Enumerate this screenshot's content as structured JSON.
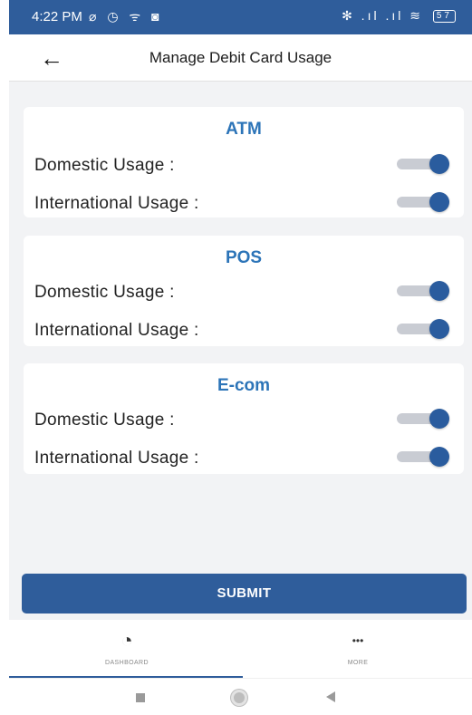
{
  "status_bar": {
    "time": "4:22 PM",
    "left_icons": "⌀ ◷ ᯤ ◙",
    "right_icons": "✻ .ıl .ıl ≋",
    "battery": "57"
  },
  "header": {
    "back_icon": "arrow-left-icon",
    "back_glyph": "←",
    "title": "Manage Debit Card Usage"
  },
  "sections": [
    {
      "title": "ATM",
      "rows": [
        {
          "label": "Domestic Usage :",
          "enabled": true
        },
        {
          "label": "International Usage :",
          "enabled": true
        }
      ]
    },
    {
      "title": "POS",
      "rows": [
        {
          "label": "Domestic Usage :",
          "enabled": true
        },
        {
          "label": "International Usage :",
          "enabled": true
        }
      ]
    },
    {
      "title": "E-com",
      "rows": [
        {
          "label": "Domestic Usage :",
          "enabled": true
        },
        {
          "label": "International Usage :",
          "enabled": true
        }
      ]
    }
  ],
  "submit_label": "SUBMIT",
  "bottom_nav": {
    "items": [
      {
        "icon": "dashboard-icon",
        "glyph": "◔",
        "label": "DASHBOARD"
      },
      {
        "icon": "more-icon",
        "glyph": "•••",
        "label": "MORE"
      }
    ]
  },
  "colors": {
    "primary": "#2f5d9b",
    "section_title": "#2c74b8",
    "background": "#f2f3f5"
  }
}
